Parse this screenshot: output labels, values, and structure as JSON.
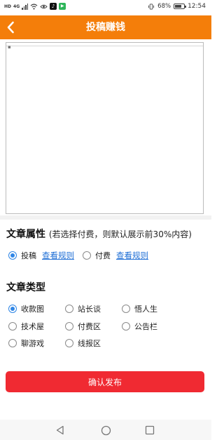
{
  "status_bar": {
    "carrier_marks": [
      "HD",
      "4G"
    ],
    "battery": "68%",
    "time": "12:54",
    "icons": [
      "sim-hd-icon",
      "signal-icon",
      "wifi-icon",
      "eye-icon",
      "tiktok-icon",
      "media-icon",
      "vibrate-icon",
      "battery-icon"
    ]
  },
  "header": {
    "title": "投稿赚钱",
    "back_icon": "chevron-left-icon",
    "background": "#f47e0a"
  },
  "editor": {
    "content": ""
  },
  "article_attr": {
    "title": "文章属性",
    "note": "(若选择付费，则默认展示前30%内容)",
    "options": [
      {
        "label": "投稿",
        "selected": true,
        "link": "查看规则"
      },
      {
        "label": "付费",
        "selected": false,
        "link": "查看规则"
      }
    ]
  },
  "article_type": {
    "title": "文章类型",
    "options": [
      {
        "label": "收款图",
        "selected": true
      },
      {
        "label": "站长谈",
        "selected": false
      },
      {
        "label": "悟人生",
        "selected": false
      },
      {
        "label": "技术屋",
        "selected": false
      },
      {
        "label": "付费区",
        "selected": false
      },
      {
        "label": "公告栏",
        "selected": false
      },
      {
        "label": "聊游戏",
        "selected": false
      },
      {
        "label": "线报区",
        "selected": false
      }
    ]
  },
  "confirm_button": {
    "label": "确认发布",
    "color": "#f02a32"
  },
  "nav_bar": {
    "icons": [
      "nav-back-icon",
      "nav-home-icon",
      "nav-recents-icon"
    ]
  }
}
